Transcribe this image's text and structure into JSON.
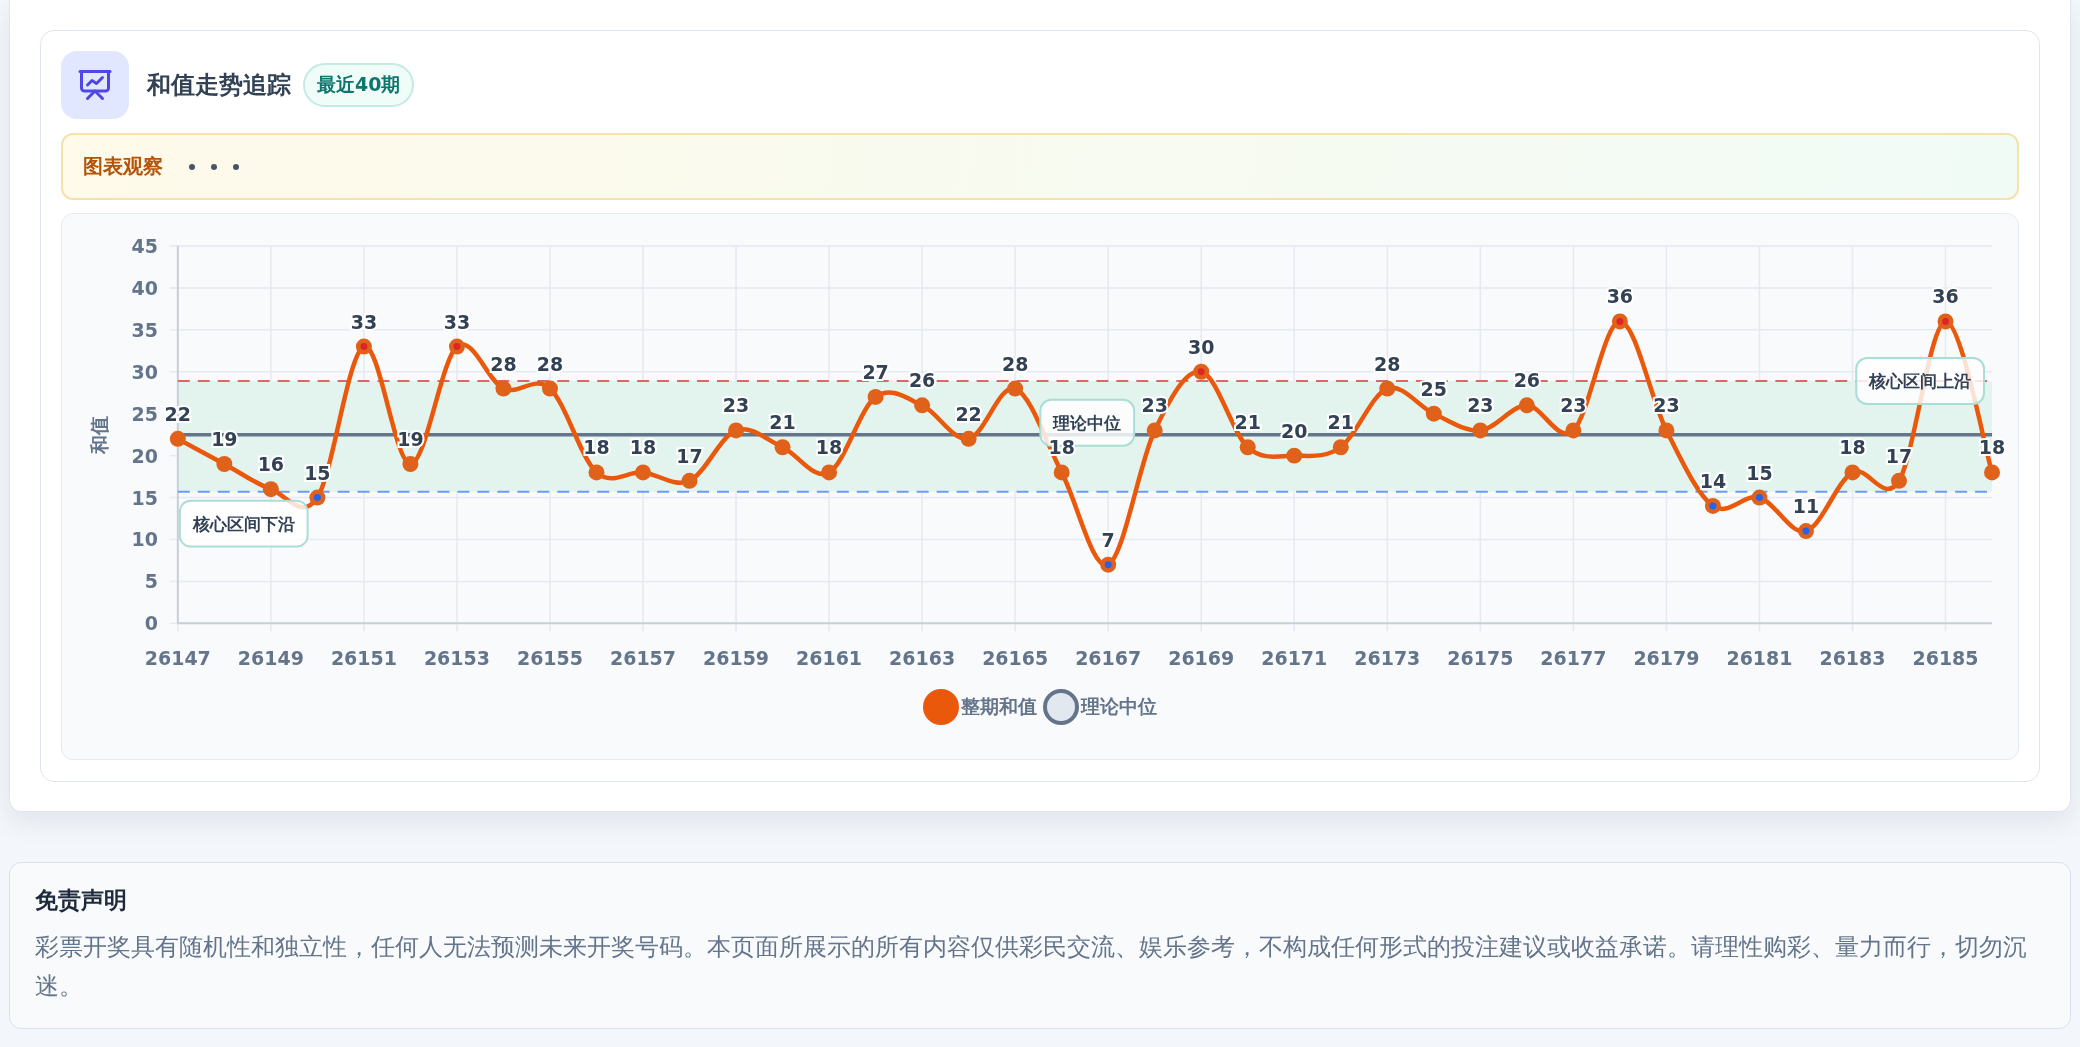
{
  "header": {
    "title": "和值走势追踪",
    "badge": "最近40期"
  },
  "observation": {
    "label": "图表观察",
    "loading": true
  },
  "chart": {
    "chart_data": {
      "type": "line",
      "ylabel": "和值",
      "grid": true,
      "x": [
        26147,
        26148,
        26149,
        26150,
        26151,
        26152,
        26153,
        26154,
        26155,
        26156,
        26157,
        26158,
        26159,
        26160,
        26161,
        26162,
        26163,
        26164,
        26165,
        26166,
        26167,
        26168,
        26169,
        26170,
        26171,
        26172,
        26173,
        26174,
        26175,
        26176,
        26177,
        26178,
        26179,
        26180,
        26181,
        26182,
        26183,
        26184,
        26185,
        26186
      ],
      "series": [
        {
          "name": "整期和值",
          "color": "#ea580c",
          "marker": "o",
          "values": [
            22,
            19,
            16,
            15,
            33,
            19,
            33,
            28,
            28,
            18,
            18,
            17,
            23,
            21,
            18,
            27,
            26,
            22,
            28,
            18,
            7,
            23,
            30,
            21,
            20,
            21,
            28,
            25,
            23,
            26,
            23,
            36,
            23,
            14,
            15,
            11,
            18,
            17,
            36,
            18
          ]
        }
      ],
      "xlim": [
        26147,
        26186
      ],
      "xticks": [
        26147,
        26149,
        26151,
        26153,
        26155,
        26157,
        26159,
        26161,
        26163,
        26165,
        26167,
        26169,
        26171,
        26173,
        26175,
        26177,
        26179,
        26181,
        26183,
        26185
      ],
      "ylim": [
        0,
        45
      ],
      "yticks": [
        0,
        5,
        10,
        15,
        20,
        25,
        30,
        35,
        40,
        45
      ],
      "data_labels": true,
      "ref_lines": [
        {
          "axis": "y",
          "value": 15.7,
          "label": "核心区间下沿",
          "color": "#6b9cf5"
        },
        {
          "axis": "y",
          "value": 22.5,
          "label": "理论中位",
          "color": "#64748b"
        },
        {
          "axis": "y",
          "value": 28.9,
          "label": "核心区间上沿",
          "color": "#e06666"
        }
      ],
      "bands": [
        {
          "axis": "y",
          "from": 15.7,
          "to": 28.9,
          "color": "#e3f4ef"
        }
      ]
    },
    "legend_extra": [
      {
        "label": "理论中位",
        "color": "#64748b"
      }
    ]
  },
  "disclaimer": {
    "title": "免责声明",
    "text": "彩票开奖具有随机性和独立性，任何人无法预测未来开奖号码。本页面所展示的所有内容仅供彩民交流、娱乐参考，不构成任何形式的投注建议或收益承诺。请理性购彩、量力而行，切勿沉迷。"
  }
}
